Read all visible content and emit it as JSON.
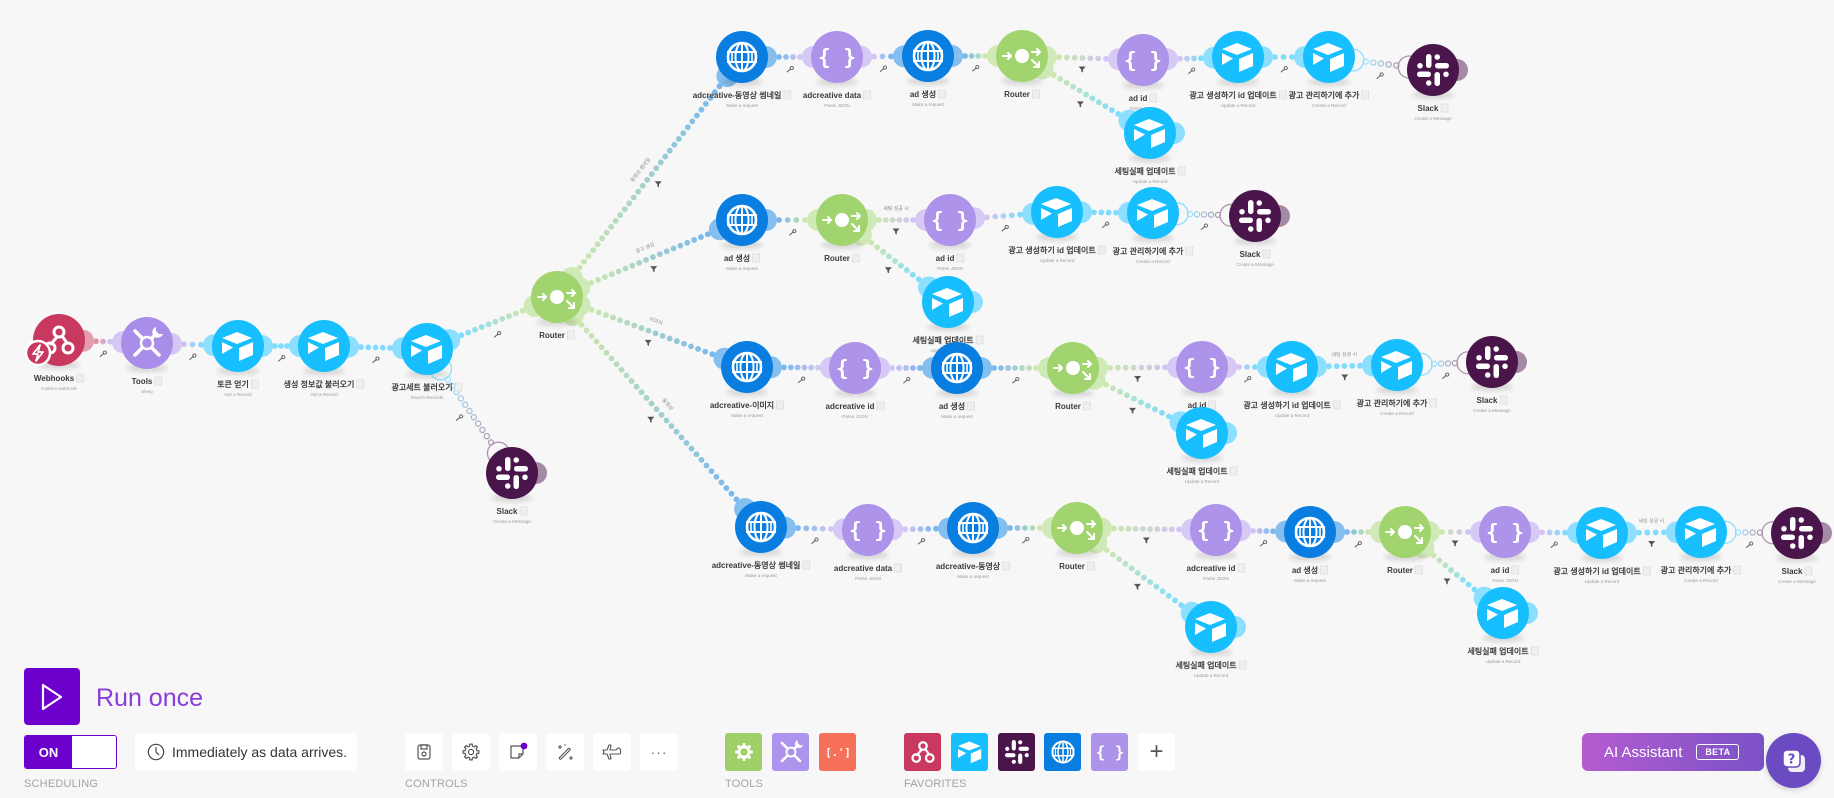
{
  "scenario": {
    "app_colors": {
      "webhooks": "#c8385f",
      "tools": "#a98ee9",
      "airtable": "#18bfff",
      "slack": "#4a154b",
      "http": "#0a7ee0",
      "json": "#ad93ea",
      "router": "#a1d46e"
    },
    "nodes": [
      {
        "id": "n1",
        "app": "webhooks",
        "name": "Webhooks",
        "action": "Custom webhook",
        "trigger": true
      },
      {
        "id": "n2",
        "app": "tools",
        "name": "Tools",
        "action": "Sleep"
      },
      {
        "id": "n3",
        "app": "airtable",
        "name": "토큰 얻기",
        "action": "Get a Record"
      },
      {
        "id": "n4",
        "app": "airtable",
        "name": "생성 정보값 불러오기",
        "action": "Get a Record"
      },
      {
        "id": "n5",
        "app": "airtable",
        "name": "광고세트 불러오기",
        "action": "Search Records"
      },
      {
        "id": "n6",
        "app": "slack",
        "name": "Slack",
        "action": "Create a Message"
      },
      {
        "id": "n7",
        "app": "router",
        "name": "Router",
        "action": ""
      },
      {
        "id": "a1",
        "app": "http",
        "name": "adcreative-동영상 썸네일",
        "action": "Make a request"
      },
      {
        "id": "a2",
        "app": "json",
        "name": "adcreative data",
        "action": "Parse JSON"
      },
      {
        "id": "a3",
        "app": "http",
        "name": "ad 생성",
        "action": "Make a request"
      },
      {
        "id": "a4",
        "app": "router",
        "name": "Router",
        "action": ""
      },
      {
        "id": "a5",
        "app": "json",
        "name": "ad id",
        "action": "Parse JSON"
      },
      {
        "id": "a6",
        "app": "airtable",
        "name": "광고 생성하기 id 업데이트",
        "action": "Update a Record"
      },
      {
        "id": "a7",
        "app": "airtable",
        "name": "광고 관리하기에 추가",
        "action": "Create a Record"
      },
      {
        "id": "a8",
        "app": "slack",
        "name": "Slack",
        "action": "Create a Message"
      },
      {
        "id": "a9",
        "app": "airtable",
        "name": "세팅실패 업데이트",
        "action": "Update a Record"
      },
      {
        "id": "b1",
        "app": "http",
        "name": "ad 생성",
        "action": "Make a request"
      },
      {
        "id": "b2",
        "app": "router",
        "name": "Router",
        "action": ""
      },
      {
        "id": "b3",
        "app": "json",
        "name": "ad id",
        "action": "Parse JSON"
      },
      {
        "id": "b4",
        "app": "airtable",
        "name": "광고 생성하기 id 업데이트",
        "action": "Update a Record"
      },
      {
        "id": "b5",
        "app": "airtable",
        "name": "광고 관리하기에 추가",
        "action": "Create a Record"
      },
      {
        "id": "b6",
        "app": "slack",
        "name": "Slack",
        "action": "Create a Message"
      },
      {
        "id": "b7",
        "app": "airtable",
        "name": "세팅실패 업데이트",
        "action": "Update a Record"
      },
      {
        "id": "c1",
        "app": "http",
        "name": "adcreative-이미지",
        "action": "Make a request"
      },
      {
        "id": "c2",
        "app": "json",
        "name": "adcreative id",
        "action": "Parse JSON"
      },
      {
        "id": "c3",
        "app": "http",
        "name": "ad 생성",
        "action": "Make a request"
      },
      {
        "id": "c4",
        "app": "router",
        "name": "Router",
        "action": ""
      },
      {
        "id": "c5",
        "app": "json",
        "name": "ad id",
        "action": "Parse JSON"
      },
      {
        "id": "c6",
        "app": "airtable",
        "name": "광고 생성하기 id 업데이트",
        "action": "Update a Record"
      },
      {
        "id": "c7",
        "app": "airtable",
        "name": "광고 관리하기에 추가",
        "action": "Create a Record"
      },
      {
        "id": "c8",
        "app": "slack",
        "name": "Slack",
        "action": "Create a Message"
      },
      {
        "id": "c9",
        "app": "airtable",
        "name": "세팅실패 업데이트",
        "action": "Update a Record"
      },
      {
        "id": "d1",
        "app": "http",
        "name": "adcreative-동영상 썸네일",
        "action": "Make a request"
      },
      {
        "id": "d2",
        "app": "json",
        "name": "adcreative data",
        "action": "Parse JSON"
      },
      {
        "id": "d3",
        "app": "http",
        "name": "adcreative-동영상",
        "action": "Make a request"
      },
      {
        "id": "d4",
        "app": "router",
        "name": "Router",
        "action": ""
      },
      {
        "id": "d5",
        "app": "json",
        "name": "adcreative id",
        "action": "Parse JSON"
      },
      {
        "id": "d6",
        "app": "airtable",
        "name": "세팅실패 업데이트",
        "action": "Update a Record"
      },
      {
        "id": "d7",
        "app": "http",
        "name": "ad 생성",
        "action": "Make a request"
      },
      {
        "id": "d8",
        "app": "router",
        "name": "Router",
        "action": ""
      },
      {
        "id": "d9",
        "app": "json",
        "name": "ad id",
        "action": "Parse JSON"
      },
      {
        "id": "d10",
        "app": "airtable",
        "name": "광고 생성하기 id 업데이트",
        "action": "Update a Record"
      },
      {
        "id": "d11",
        "app": "airtable",
        "name": "광고 관리하기에 추가",
        "action": "Create a Record"
      },
      {
        "id": "d12",
        "app": "slack",
        "name": "Slack",
        "action": "Create a Message"
      },
      {
        "id": "d13",
        "app": "airtable",
        "name": "세팅실패 업데이트",
        "action": "Update a Record"
      }
    ],
    "links": [
      {
        "from": "n1",
        "to": "n2"
      },
      {
        "from": "n2",
        "to": "n3"
      },
      {
        "from": "n3",
        "to": "n4"
      },
      {
        "from": "n4",
        "to": "n5"
      },
      {
        "from": "n5",
        "to": "n7"
      },
      {
        "from": "n5",
        "to": "n6",
        "style": "hollow"
      },
      {
        "from": "n7",
        "to": "a1",
        "filter": true,
        "label": "동영상 썸네일"
      },
      {
        "from": "n7",
        "to": "b1",
        "filter": true,
        "label": "광고 생성"
      },
      {
        "from": "n7",
        "to": "c1",
        "filter": true,
        "label": "이미지"
      },
      {
        "from": "n7",
        "to": "d1",
        "filter": true,
        "label": "동영상"
      },
      {
        "from": "a1",
        "to": "a2"
      },
      {
        "from": "a2",
        "to": "a3"
      },
      {
        "from": "a3",
        "to": "a4"
      },
      {
        "from": "a4",
        "to": "a5",
        "filter": true
      },
      {
        "from": "a4",
        "to": "a9",
        "filter": true
      },
      {
        "from": "a5",
        "to": "a6"
      },
      {
        "from": "a6",
        "to": "a7"
      },
      {
        "from": "a7",
        "to": "a8",
        "style": "hollow"
      },
      {
        "from": "b1",
        "to": "b2"
      },
      {
        "from": "b2",
        "to": "b3",
        "filter": true,
        "label": "세팅 성공 시"
      },
      {
        "from": "b2",
        "to": "b7",
        "filter": true
      },
      {
        "from": "b3",
        "to": "b4"
      },
      {
        "from": "b4",
        "to": "b5"
      },
      {
        "from": "b5",
        "to": "b6",
        "style": "hollow"
      },
      {
        "from": "c1",
        "to": "c2"
      },
      {
        "from": "c2",
        "to": "c3"
      },
      {
        "from": "c3",
        "to": "c4"
      },
      {
        "from": "c4",
        "to": "c5",
        "filter": true
      },
      {
        "from": "c4",
        "to": "c9",
        "filter": true
      },
      {
        "from": "c5",
        "to": "c6"
      },
      {
        "from": "c6",
        "to": "c7",
        "filter": true,
        "label": "세팅 성공 시"
      },
      {
        "from": "c7",
        "to": "c8",
        "style": "hollow"
      },
      {
        "from": "d1",
        "to": "d2"
      },
      {
        "from": "d2",
        "to": "d3"
      },
      {
        "from": "d3",
        "to": "d4"
      },
      {
        "from": "d4",
        "to": "d5",
        "filter": true
      },
      {
        "from": "d4",
        "to": "d6",
        "filter": true
      },
      {
        "from": "d5",
        "to": "d7"
      },
      {
        "from": "d7",
        "to": "d8"
      },
      {
        "from": "d8",
        "to": "d9",
        "filter": true
      },
      {
        "from": "d8",
        "to": "d13",
        "filter": true
      },
      {
        "from": "d9",
        "to": "d10"
      },
      {
        "from": "d10",
        "to": "d11",
        "filter": true,
        "label": "세팅 성공 시"
      },
      {
        "from": "d11",
        "to": "d12",
        "style": "hollow"
      }
    ]
  },
  "toolbar": {
    "run_once": {
      "label": "Run once",
      "color": "#6d00cc"
    },
    "scheduling": {
      "toggle_label": "ON",
      "toggle_state": "on",
      "schedule_text": "Immediately as data arrives.",
      "section_label": "SCHEDULING"
    },
    "controls": {
      "section_label": "CONTROLS",
      "buttons": [
        {
          "name": "save",
          "icon": "save-icon"
        },
        {
          "name": "scenario-settings",
          "icon": "gear-icon"
        },
        {
          "name": "notes",
          "icon": "note-icon",
          "indicator_color": "#6d00cc"
        },
        {
          "name": "auto-align",
          "icon": "magic-wand-icon"
        },
        {
          "name": "explain-flow",
          "icon": "airplane-icon"
        },
        {
          "name": "more",
          "icon": "more-icon",
          "label": "···"
        }
      ]
    },
    "tools": {
      "section_label": "TOOLS",
      "items": [
        {
          "name": "flow-control",
          "icon": "gear-icon",
          "color": "#9fd068"
        },
        {
          "name": "tools",
          "icon": "tools-icon",
          "color": "#ad94ec"
        },
        {
          "name": "text-parser",
          "icon": "text-parser-icon",
          "color": "#f7705a",
          "glyph_text": "[.']"
        }
      ]
    },
    "favorites": {
      "section_label": "FAVORITES",
      "items": [
        {
          "name": "webhooks",
          "icon": "webhooks-icon",
          "color": "#c8385f"
        },
        {
          "name": "airtable",
          "icon": "airtable-icon",
          "color": "#18bfff"
        },
        {
          "name": "slack",
          "icon": "slack-icon",
          "color": "#4a154b"
        },
        {
          "name": "http",
          "icon": "http-globe-icon",
          "color": "#0a7ee0"
        },
        {
          "name": "json",
          "icon": "json-icon",
          "color": "#ad93ea"
        }
      ],
      "add_label": "+"
    },
    "ai_assistant": {
      "label": "AI Assistant",
      "badge": "BETA"
    },
    "help": {
      "icon": "help-icon",
      "color": "#6b4bc2"
    }
  }
}
